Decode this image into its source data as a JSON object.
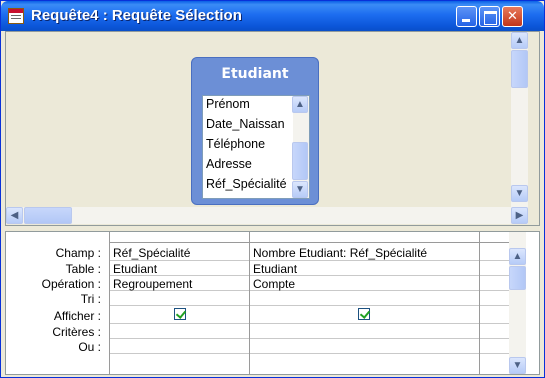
{
  "window": {
    "title": "Requête4 : Requête Sélection"
  },
  "field_list": {
    "title": "Etudiant",
    "fields": [
      "Prénom",
      "Date_Naissan",
      "Téléphone",
      "Adresse",
      "Réf_Spécialité"
    ]
  },
  "grid": {
    "row_labels": [
      "Champ :",
      "Table :",
      "Opération :",
      "Tri :",
      "Afficher :",
      "Critères :",
      "Ou :"
    ],
    "columns": [
      {
        "champ": "Réf_Spécialité",
        "table": "Etudiant",
        "operation": "Regroupement",
        "tri": "",
        "afficher": true,
        "criteres": "",
        "ou": ""
      },
      {
        "champ": "Nombre Etudiant: Réf_Spécialité",
        "table": "Etudiant",
        "operation": "Compte",
        "tri": "",
        "afficher": true,
        "criteres": "",
        "ou": ""
      }
    ]
  },
  "icons": {
    "app": "access-query-icon",
    "minimize": "minimize-icon",
    "maximize": "maximize-icon",
    "close": "close-icon"
  },
  "colors": {
    "titlebar": "#0a5fe6",
    "field_list_header": "#6c8fd6",
    "close_button": "#c2351a"
  }
}
